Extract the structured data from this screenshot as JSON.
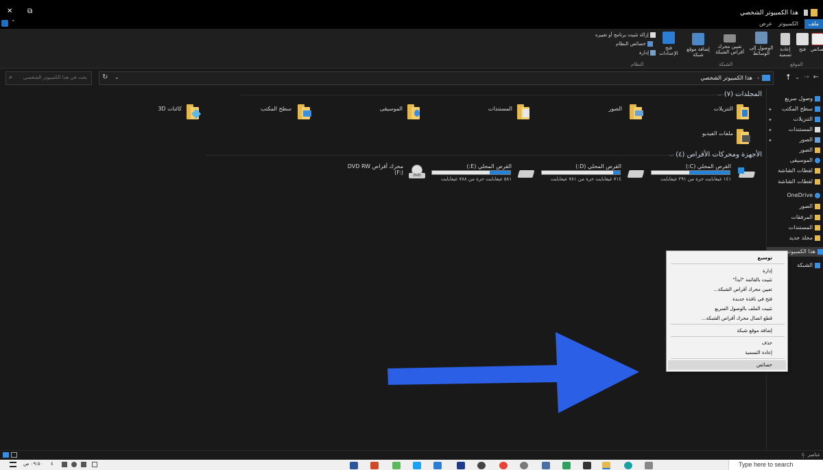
{
  "window": {
    "title": "هذا الكمبيوتر الشخصي",
    "controls": {
      "close": "✕",
      "restore": "⧉",
      "minimize": "—"
    }
  },
  "ribbon_tabs": [
    "ملف",
    "الكمبيوتر",
    "عرض"
  ],
  "ribbon": {
    "location_group": {
      "label": "الموقع",
      "buttons": [
        "خصائص",
        "فتح",
        "إعادة تسمية"
      ]
    },
    "network_group": {
      "label": "الشبكة",
      "buttons": [
        "الوصول إلى الوسائط",
        "تعيين محرك أقراص الشبكة",
        "إضافة موقع شبكة"
      ]
    },
    "system_group": {
      "label": "النظام",
      "open_settings": "فتح الإعدادات",
      "items": [
        "إزالة تثبيت برنامج أو تغييره",
        "خصائص النظام",
        "إدارة"
      ]
    }
  },
  "address": {
    "path": "هذا الكمبيوتر الشخصي",
    "search_placeholder": "بحث في هذا الكمبيوتر الشخصي"
  },
  "sections": {
    "folders_header": "المجلدات (٧)",
    "devices_header": "الأجهزة ومحركات الأقراص (٤)"
  },
  "folders": [
    {
      "name": "التنزيلات",
      "color": "#2a7fd4"
    },
    {
      "name": "الصور",
      "color": "#6aa0d8"
    },
    {
      "name": "المستندات",
      "color": "#e0e0e0"
    },
    {
      "name": "الموسيقى",
      "color": "#3b8fe0"
    },
    {
      "name": "سطح المكتب",
      "color": "#3b8fe0"
    },
    {
      "name": "كائنات 3D",
      "color": "#5fb8e8"
    },
    {
      "name": "ملفات الفيديو",
      "color": "#555"
    }
  ],
  "drives": [
    {
      "name": "القرص المحلي (C:)",
      "free": "١٤١ غيغابايت حرة من ٢٩١ غيغابايت",
      "used_fraction": 0.52
    },
    {
      "name": "القرص المحلي (D:)",
      "free": "٧١٤ غيغابايت حرة من ٧٨١ غيغابايت",
      "used_fraction": 0.09
    },
    {
      "name": "القرص المحلي (E:)",
      "free": "٥٨١ غيغابايت حرة من ٧٨٨ غيغابايت",
      "used_fraction": 0.26
    },
    {
      "name": "محرك أقراص DVD RW (F:)",
      "free": "",
      "used_fraction": 0
    }
  ],
  "nav": {
    "items": [
      "وصول سريع",
      "سطح المكتب",
      "التنزيلات",
      "المستندات",
      "الصور",
      "الصور",
      "الموسيقى",
      "لقطات الشاشة",
      "لقطات الشاشة",
      "OneDrive",
      "الصور",
      "المرفقات",
      "المستندات",
      "مجلد جديد",
      "هذا الكمبيوتر",
      "الشبكة"
    ]
  },
  "context_menu": {
    "items": [
      "توسيع",
      "إدارة",
      "تثبيت بالقائمة \"ابدأ\"",
      "تعيين محرك أقراص الشبكة...",
      "فتح في نافذة جديدة",
      "تثبيت الملف بالوصول السريع",
      "قطع اتصال محرك أقراص الشبكة...",
      "إضافة موقع شبكة",
      "حذف",
      "إعادة التسمية",
      "خصائص"
    ]
  },
  "status": {
    "count": "عناصر ١٠"
  },
  "taskbar": {
    "search": "Type here to search",
    "time": "٠٩:٥٠ ص",
    "date": "٤"
  },
  "arrow_color": "#2a5fe6"
}
